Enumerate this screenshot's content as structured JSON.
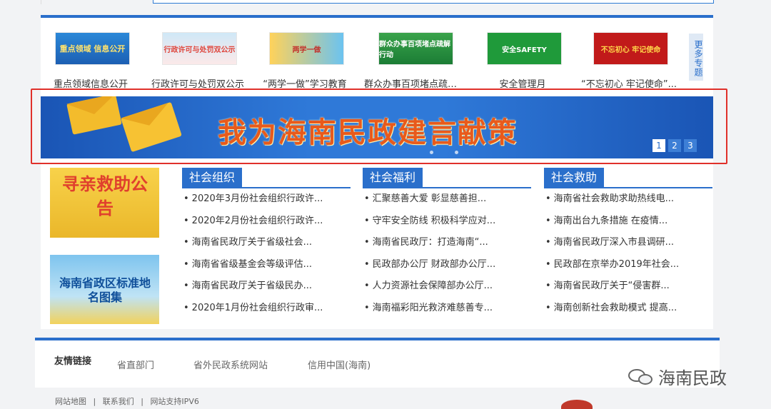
{
  "themes": [
    {
      "label": "重点领域信息公开",
      "thumb_text": "重点领域 信息公开",
      "icon": "info-public-thumb"
    },
    {
      "label": "行政许可与处罚双公示",
      "thumb_text": "行政许可与处罚双公示",
      "icon": "permit-thumb"
    },
    {
      "label": "“两学一做”学习教育",
      "thumb_text": "两学一做",
      "icon": "study-thumb"
    },
    {
      "label": "群众办事百项堵点疏解...",
      "thumb_text": "群众办事百项堵点疏解行动",
      "icon": "service-thumb"
    },
    {
      "label": "安全管理月",
      "thumb_text": "安全SAFETY",
      "icon": "safety-thumb"
    },
    {
      "label": "“不忘初心 牢记使命”...",
      "thumb_text": "不忘初心 牢记使命",
      "icon": "mission-thumb"
    }
  ],
  "more_themes": "更多专题",
  "banner": {
    "title": "我为海南民政建言献策",
    "pages": [
      "1",
      "2",
      "3"
    ],
    "active_page": 1
  },
  "side_images": {
    "first": "寻亲救助公告",
    "second": "海南省政区标准地名图集"
  },
  "columns": [
    {
      "title": "社会组织",
      "items": [
        "2020年3月份社会组织行政许...",
        "2020年2月份社会组织行政许...",
        "海南省民政厅关于省级社会...",
        "海南省省级基金会等级评估...",
        "海南省民政厅关于省级民办...",
        "2020年1月份社会组织行政审..."
      ]
    },
    {
      "title": "社会福利",
      "items": [
        "汇聚慈善大爱 彰显慈善担...",
        "守牢安全防线 积极科学应对...",
        "海南省民政厅：打造海南“...",
        "民政部办公厅 财政部办公厅...",
        "人力资源社会保障部办公厅...",
        "海南福彩阳光救济难慈善专..."
      ]
    },
    {
      "title": "社会救助",
      "items": [
        "海南省社会救助求助热线电...",
        "海南出台九条措施 在疫情...",
        "海南省民政厅深入市县调研...",
        "民政部在京举办2019年社会...",
        "海南省民政厅关于“侵害群...",
        "海南创新社会救助模式 提高..."
      ]
    }
  ],
  "friend_links": {
    "label": "友情链接",
    "links": [
      "省直部门",
      "省外民政系统网站",
      "信用中国(海南)"
    ]
  },
  "footer_links": [
    "网站地图",
    "|",
    "联系我们",
    "|",
    "网站支持IPV6"
  ],
  "watermark": "海南民政",
  "colors": {
    "accent": "#2a6fcb",
    "highlight": "#e0302a"
  }
}
